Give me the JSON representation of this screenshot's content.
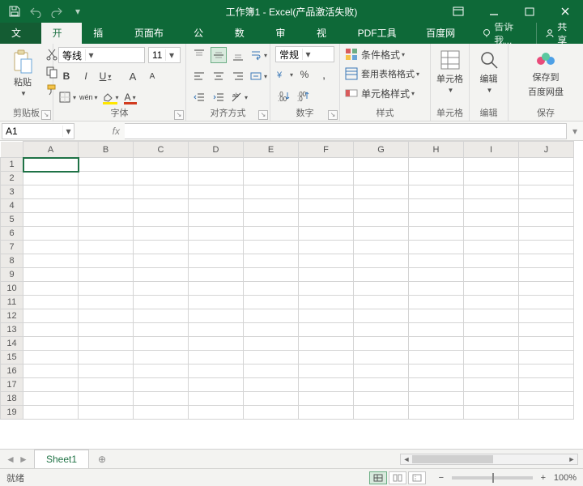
{
  "titlebar": {
    "title": "工作簿1 - Excel(产品激活失败)"
  },
  "tabs": {
    "file": "文件",
    "items": [
      "开始",
      "插入",
      "页面布局",
      "公式",
      "数据",
      "审阅",
      "视图",
      "PDF工具集",
      "百度网盘"
    ],
    "active": "开始",
    "tell_me": "告诉我...",
    "share": "共享"
  },
  "ribbon": {
    "clipboard": {
      "label": "剪贴板",
      "paste": "粘贴"
    },
    "font": {
      "label": "字体",
      "name": "等线",
      "size": "11",
      "bold": "B",
      "italic": "I",
      "underline": "U",
      "increase": "A",
      "decrease": "A",
      "wen": "wén",
      "fontcolor_letter": "A"
    },
    "alignment": {
      "label": "对齐方式"
    },
    "number": {
      "label": "数字",
      "format": "常规",
      "percent": "%"
    },
    "styles": {
      "label": "样式",
      "conditional": "条件格式",
      "table": "套用表格格式",
      "cell": "单元格样式"
    },
    "cells": {
      "label": "单元格"
    },
    "editing": {
      "label": "编辑"
    },
    "baidu": {
      "label": "保存",
      "save": "保存到",
      "save2": "百度网盘"
    }
  },
  "namebox": {
    "ref": "A1"
  },
  "sheet": {
    "columns": [
      "A",
      "B",
      "C",
      "D",
      "E",
      "F",
      "G",
      "H",
      "I",
      "J"
    ],
    "rows": 19,
    "tab_name": "Sheet1"
  },
  "status": {
    "ready": "就绪",
    "zoom": "100%"
  }
}
